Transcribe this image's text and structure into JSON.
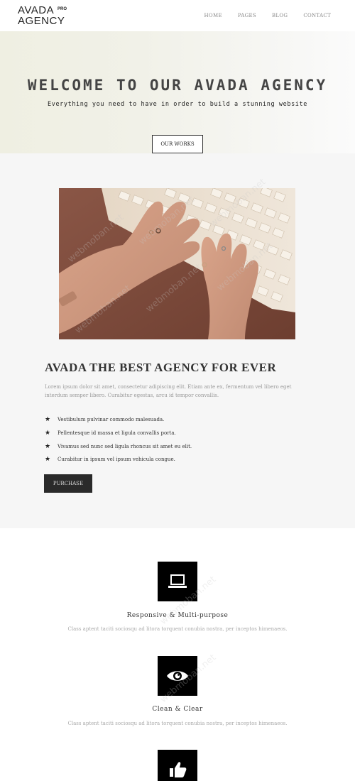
{
  "header": {
    "logo_line1": "AVADA",
    "logo_pro": "PRO",
    "logo_line2": "AGENCY",
    "nav": [
      "HOME",
      "PAGES",
      "BLOG",
      "CONTACT"
    ]
  },
  "hero": {
    "title": "WELCOME TO OUR AVADA AGENCY",
    "subtitle": "Everything you need to have in order to build a stunning website",
    "button": "OUR WORKS"
  },
  "about": {
    "title": "AVADA THE BEST AGENCY FOR EVER",
    "text": "Lorem ipsum dolor sit amet, consectetur adipiscing elit. Etiam ante ex, fermentum vel libero eget interdum semper libero. Curabitur egestas, arcu id tempor convallis.",
    "bullets": [
      "Vestibulum pulvinar commodo malesuada.",
      "Pellentesque id massa et ligula convallis porta.",
      "Vivamus sed nunc sed ligula rhoncus sit amet eu elit.",
      "Curabitur in ipsum vel ipsum vehicula congue."
    ],
    "button": "PURCHASE"
  },
  "features": [
    {
      "icon": "laptop-icon",
      "title": "Responsive & Multi-purpose",
      "text": "Class aptent taciti sociosqu ad litora torquent conubia nostra, per inceptos himenaeos."
    },
    {
      "icon": "eye-icon",
      "title": "Clean & Clear",
      "text": "Class aptent taciti sociosqu ad litora torquent conubia nostra, per inceptos himenaeos."
    },
    {
      "icon": "thumbs-up-icon",
      "title": "",
      "text": ""
    }
  ],
  "watermark": "webmoban.net"
}
